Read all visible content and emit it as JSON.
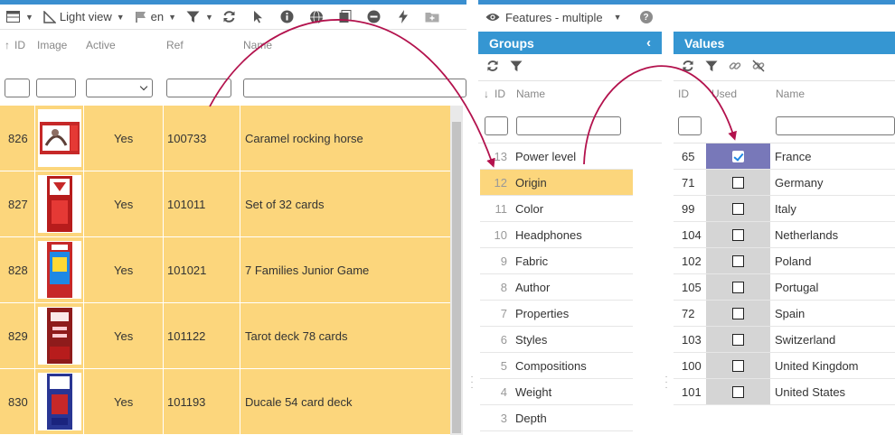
{
  "left_toolbar": {
    "view_label": "Light view",
    "lang_label": "en"
  },
  "left_table": {
    "columns": [
      "ID",
      "Image",
      "Active",
      "Ref",
      "Name"
    ],
    "rows": [
      {
        "id": "826",
        "active": "Yes",
        "ref": "100733",
        "name": "Caramel rocking horse"
      },
      {
        "id": "827",
        "active": "Yes",
        "ref": "101011",
        "name": "Set of 32 cards"
      },
      {
        "id": "828",
        "active": "Yes",
        "ref": "101021",
        "name": "7 Families Junior Game"
      },
      {
        "id": "829",
        "active": "Yes",
        "ref": "101122",
        "name": "Tarot deck 78 cards"
      },
      {
        "id": "830",
        "active": "Yes",
        "ref": "101193",
        "name": "Ducale 54 card deck"
      }
    ]
  },
  "right_toolbar": {
    "features_label": "Features - multiple",
    "help": "?"
  },
  "groups": {
    "title": "Groups",
    "columns": [
      "ID",
      "Name"
    ],
    "rows": [
      {
        "id": "13",
        "name": "Power level"
      },
      {
        "id": "12",
        "name": "Origin"
      },
      {
        "id": "11",
        "name": "Color"
      },
      {
        "id": "10",
        "name": "Headphones"
      },
      {
        "id": "9",
        "name": "Fabric"
      },
      {
        "id": "8",
        "name": "Author"
      },
      {
        "id": "7",
        "name": "Properties"
      },
      {
        "id": "6",
        "name": "Styles"
      },
      {
        "id": "5",
        "name": "Compositions"
      },
      {
        "id": "4",
        "name": "Weight"
      },
      {
        "id": "3",
        "name": "Depth"
      }
    ],
    "selected_id": "12"
  },
  "values": {
    "title": "Values",
    "columns": [
      "ID",
      "Used",
      "Name"
    ],
    "rows": [
      {
        "id": "65",
        "name": "France",
        "used": true
      },
      {
        "id": "71",
        "name": "Germany",
        "used": false
      },
      {
        "id": "99",
        "name": "Italy",
        "used": false
      },
      {
        "id": "104",
        "name": "Netherlands",
        "used": false
      },
      {
        "id": "102",
        "name": "Poland",
        "used": false
      },
      {
        "id": "105",
        "name": "Portugal",
        "used": false
      },
      {
        "id": "72",
        "name": "Spain",
        "used": false
      },
      {
        "id": "103",
        "name": "Switzerland",
        "used": false
      },
      {
        "id": "100",
        "name": "United Kingdom",
        "used": false
      },
      {
        "id": "101",
        "name": "United States",
        "used": false
      }
    ]
  },
  "colors": {
    "accent": "#3596d2",
    "row_highlight": "#fcd67c",
    "used_selected": "#7878b9",
    "arrow": "#b3124d"
  }
}
